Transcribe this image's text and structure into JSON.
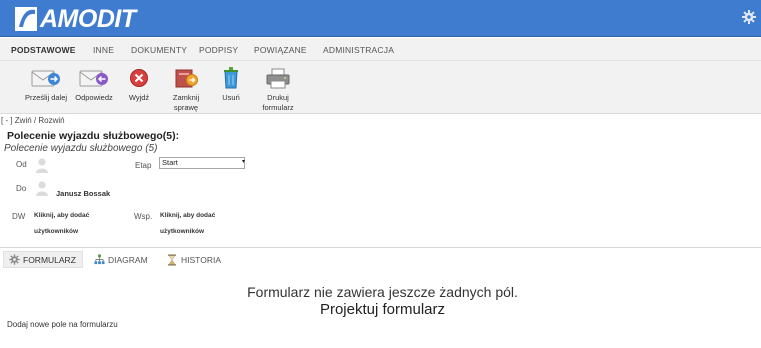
{
  "app": {
    "logo_text": "AMODIT",
    "accent_color": "#3f7cd0"
  },
  "tabs": [
    {
      "label": "PODSTAWOWE",
      "active": true
    },
    {
      "label": "INNE"
    },
    {
      "label": "DOKUMENTY"
    },
    {
      "label": "PODPISY"
    },
    {
      "label": "POWIĄZANE"
    },
    {
      "label": "ADMINISTRACJA"
    }
  ],
  "toolbar": {
    "forward": "Prześlij dalej",
    "reply": "Odpowiedz",
    "exit": "Wyjdź",
    "close_line1": "Zamknij",
    "close_line2": "sprawę",
    "delete": "Usuń",
    "print_line1": "Drukuj",
    "print_line2": "formularz"
  },
  "collapse_toggle": "[ - ] Zwiń / Rozwiń",
  "case": {
    "title": "Polecenie wyjazdu służbowego(5):",
    "subtitle": "Polecenie wyjazdu służbowego (5)",
    "from_label": "Od",
    "to_label": "Do",
    "to_name": "Janusz Bossak",
    "dw_label": "DW",
    "dw_link_line1": "Kliknij, aby dodać",
    "dw_link_line2": "użytkowników",
    "stage_label": "Etap",
    "stage_value": "Start",
    "wsp_label": "Wsp.",
    "wsp_link_line1": "Kliknij, aby dodać",
    "wsp_link_line2": "użytkowników"
  },
  "bottom_tabs": [
    {
      "label": "FORMULARZ",
      "icon": "gear-icon",
      "active": true
    },
    {
      "label": "DIAGRAM",
      "icon": "diagram-icon"
    },
    {
      "label": "HISTORIA",
      "icon": "hourglass-icon"
    }
  ],
  "form": {
    "empty_message": "Formularz nie zawiera jeszcze żadnych pól.",
    "design_link": "Projektuj formularz",
    "add_field": "Dodaj nowe pole na formularzu"
  }
}
